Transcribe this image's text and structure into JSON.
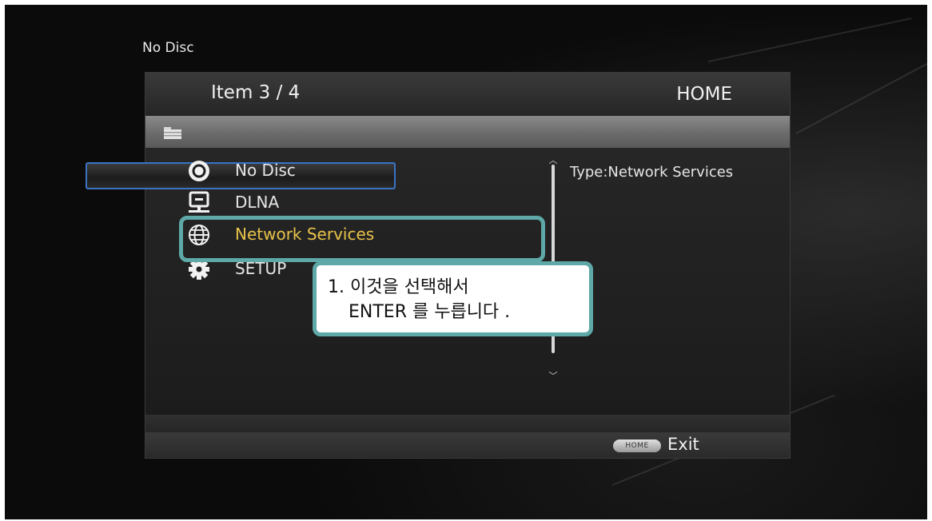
{
  "disc_status": "No Disc",
  "header": {
    "item_counter": "Item 3 / 4",
    "title": "HOME"
  },
  "menu": {
    "items": [
      {
        "label": "No Disc",
        "icon": "disc-icon"
      },
      {
        "label": "DLNA",
        "icon": "dlna-icon"
      },
      {
        "label": "Network Services",
        "icon": "globe-icon",
        "selected": true
      },
      {
        "label": "SETUP",
        "icon": "gear-icon"
      }
    ]
  },
  "info": {
    "type_text": "Type:Network Services"
  },
  "footer": {
    "home_key": "HOME",
    "exit_label": "Exit"
  },
  "callout": {
    "line1": "1. 이것을 선택해서",
    "line2": "ENTER 를 누릅니다 ."
  },
  "colors": {
    "selected_text": "#e8c24a",
    "selection_border": "#3a74c4",
    "annotation": "#5fa8a8"
  }
}
